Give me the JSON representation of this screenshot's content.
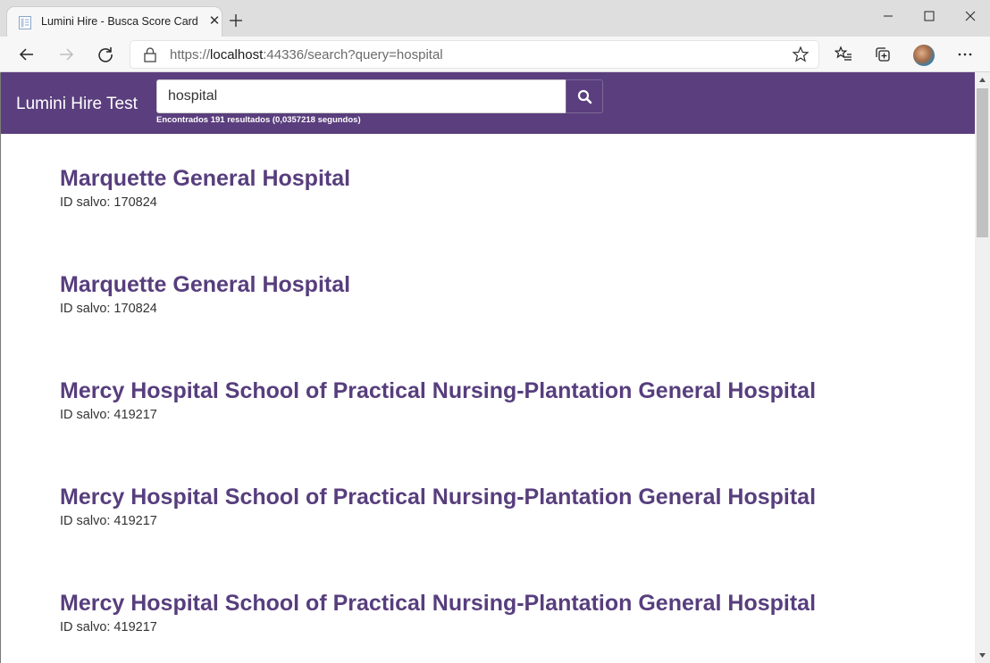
{
  "browser": {
    "tab_title": "Lumini Hire - Busca Score Card",
    "tab_close": "✕",
    "url_scheme": "https://",
    "url_host": "localhost",
    "url_rest": ":44336/search?query=hospital"
  },
  "navbar": {
    "brand": "Lumini Hire Test",
    "search_value": "hospital",
    "result_stats": "Encontrados 191 resultados (0,0357218 segundos)"
  },
  "results": [
    {
      "title": "Marquette General Hospital",
      "id_text": "ID salvo: 170824"
    },
    {
      "title": "Marquette General Hospital",
      "id_text": "ID salvo: 170824"
    },
    {
      "title": "Mercy Hospital School of Practical Nursing-Plantation General Hospital",
      "id_text": "ID salvo: 419217"
    },
    {
      "title": "Mercy Hospital School of Practical Nursing-Plantation General Hospital",
      "id_text": "ID salvo: 419217"
    },
    {
      "title": "Mercy Hospital School of Practical Nursing-Plantation General Hospital",
      "id_text": "ID salvo: 419217"
    }
  ],
  "icons": {
    "favicon": "document-icon",
    "new_tab": "plus-icon",
    "back": "arrow-left-icon",
    "forward": "arrow-right-icon",
    "refresh": "refresh-icon",
    "lock": "lock-icon",
    "favorite": "star-icon",
    "favorites_list": "favorites-list-icon",
    "collections": "collections-icon",
    "menu": "ellipsis-icon",
    "search": "search-icon"
  },
  "colors": {
    "brand": "#5a3e7d",
    "result_title": "#573e7d",
    "result_text": "#333333"
  }
}
